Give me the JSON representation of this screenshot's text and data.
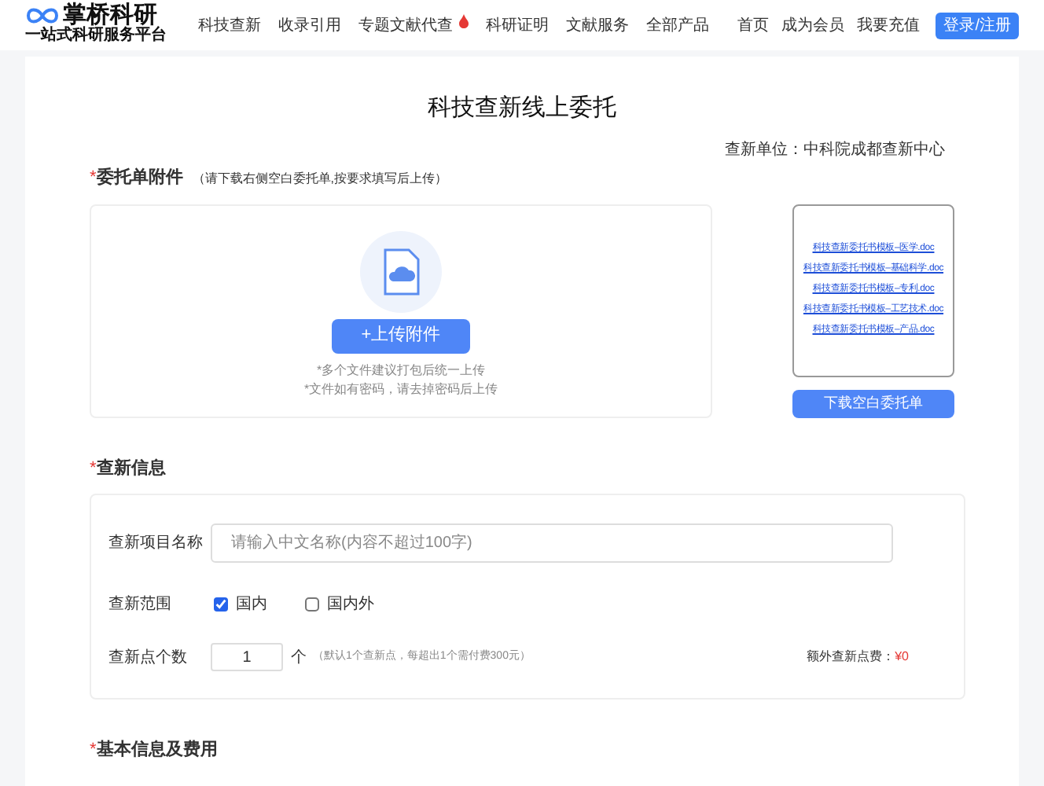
{
  "header": {
    "logo": {
      "name": "掌桥科研",
      "tagline": "一站式科研服务平台"
    },
    "nav": [
      {
        "label": "科技查新",
        "hot": false
      },
      {
        "label": "收录引用",
        "hot": false
      },
      {
        "label": "专题文献代查",
        "hot": true
      },
      {
        "label": "科研证明",
        "hot": false
      },
      {
        "label": "文献服务",
        "hot": false
      },
      {
        "label": "全部产品",
        "hot": false
      }
    ],
    "right_links": [
      "首页",
      "成为会员",
      "我要充值"
    ],
    "login_button": "登录/注册"
  },
  "page_title": "科技查新线上委托",
  "agency": "查新单位：中科院成都查新中心",
  "attachment": {
    "required_mark": "*",
    "heading": "委托单附件",
    "hint": "（请下载右侧空白委托单,按要求填写后上传）",
    "upload_button": "+上传附件",
    "notes": [
      "*多个文件建议打包后统一上传",
      "*文件如有密码，请去掉密码后上传"
    ],
    "templates": [
      "科技查新委托书模板–医学.doc",
      "科技查新委托书模板–基础科学.doc",
      "科技查新委托书模板–专利.doc",
      "科技查新委托书模板–工艺技术.doc",
      "科技查新委托书模板–产品.doc"
    ],
    "download_button": "下载空白委托单"
  },
  "info": {
    "required_mark": "*",
    "heading": "查新信息",
    "name_label": "查新项目名称",
    "name_placeholder": "请输入中文名称(内容不超过100字)",
    "scope_label": "查新范围",
    "scope_options": [
      {
        "label": "国内",
        "checked": true
      },
      {
        "label": "国内外",
        "checked": false
      }
    ],
    "count_label": "查新点个数",
    "count_value": "1",
    "count_unit": "个",
    "count_hint": "（默认1个查新点，每超出1个需付费300元）",
    "extra_fee_label": "额外查新点费：",
    "extra_fee_value": "¥0"
  },
  "basic": {
    "required_mark": "*",
    "heading": "基本信息及费用"
  }
}
